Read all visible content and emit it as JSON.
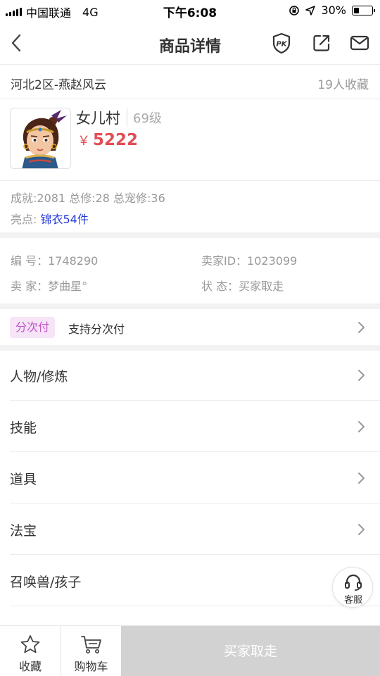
{
  "status_bar": {
    "carrier": "中国联通",
    "network": "4G",
    "time": "下午6:08",
    "battery_text": "30%",
    "battery_level": 0.3
  },
  "nav": {
    "title": "商品详情",
    "icons": [
      "back-chevron-icon",
      "pk-shield-icon",
      "share-icon",
      "mail-icon"
    ]
  },
  "server": {
    "name": "河北2区-燕赵风云",
    "favorites": "19人收藏"
  },
  "character": {
    "name": "女儿村",
    "level": "69级",
    "currency": "￥",
    "price": "5222"
  },
  "stats": {
    "line": "成就:2081 总修:28 总宠修:36",
    "highlight_label": "亮点: ",
    "highlight_value": "锦衣54件"
  },
  "info": {
    "serial": "编 号：1748290",
    "seller_id": "卖家ID：1023099",
    "seller": "卖 家：梦曲星°",
    "status": "状 态：买家取走"
  },
  "installment": {
    "tag": "分次付",
    "text": "支持分次付"
  },
  "menu": [
    {
      "label": "人物/修炼"
    },
    {
      "label": "技能"
    },
    {
      "label": "道具"
    },
    {
      "label": "法宝"
    },
    {
      "label": "召唤兽/孩子"
    }
  ],
  "customer_service": {
    "label": "客服"
  },
  "bottom_bar": {
    "favorite_label": "收藏",
    "cart_label": "购物车",
    "buy_label": "买家取走"
  },
  "colors": {
    "price": "#e04e55",
    "highlight": "#2339d6",
    "tag_text": "#c155c9",
    "tag_bg": "#f6e4f7",
    "disabled_button": "#d2d2d2"
  }
}
